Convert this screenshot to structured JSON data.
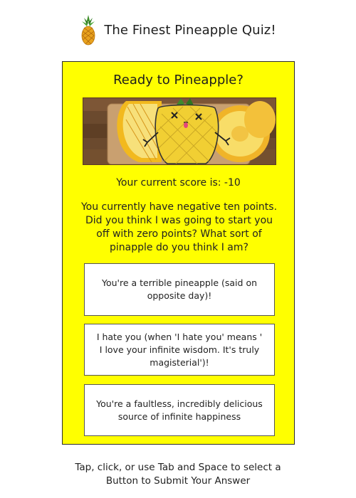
{
  "header": {
    "title": "The Finest Pineapple Quiz!",
    "logo_icon": "pineapple-icon"
  },
  "card": {
    "title": "Ready to Pineapple?",
    "hero_image": "cartoon-pineapple-with-sliced-pineapple-on-wooden-board",
    "background_color": "#ffff00",
    "score_text": "Your current score is: -10",
    "message": "You currently have negative ten points. Did you think I was going to start you off with zero points? What sort of pinapple do you think I am?",
    "answers": [
      {
        "label": "You're a terrible pineapple (said on opposite day)!"
      },
      {
        "label": "I hate you (when 'I hate you' means ' I love your infinite wisdom. It's truly magisterial')!"
      },
      {
        "label": "You're a faultless, incredibly delicious source of infinite happiness"
      }
    ]
  },
  "footer": {
    "line1": "Tap, click, or use Tab and Space to select a",
    "line2": "Button to Submit Your Answer"
  }
}
